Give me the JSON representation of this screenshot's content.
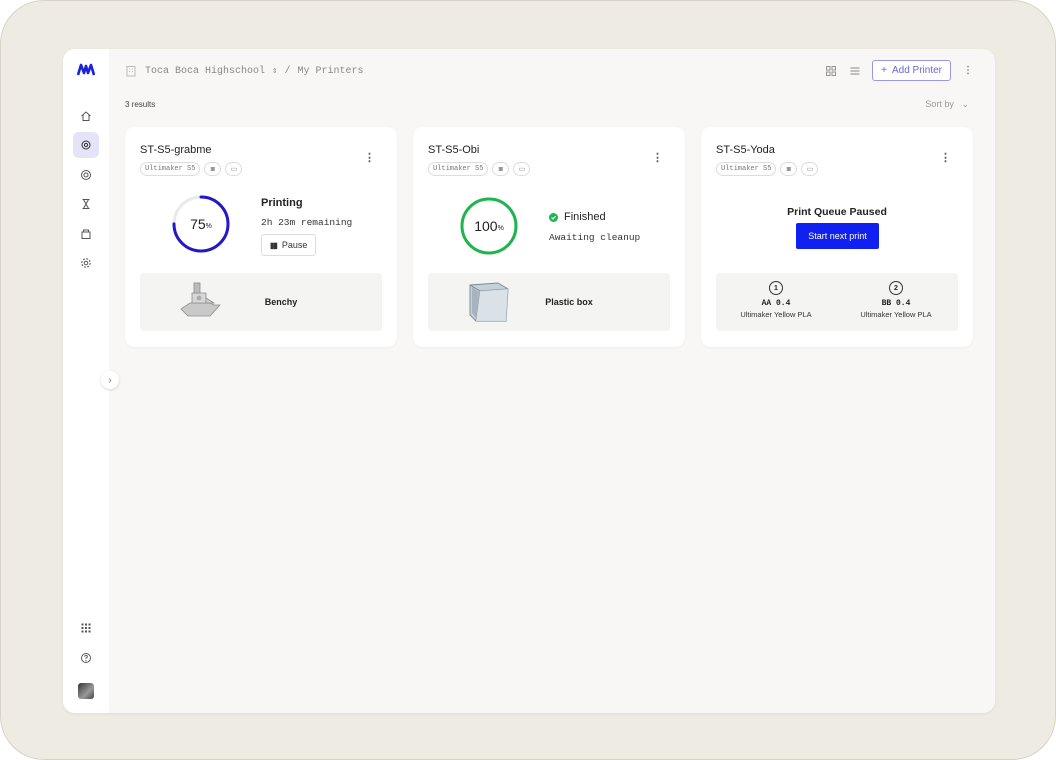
{
  "breadcrumb": {
    "org": "Toca Boca Highschool",
    "separator": "/",
    "page": "My Printers"
  },
  "toolbar": {
    "add_printer_label": "Add Printer"
  },
  "results_text": "3 results",
  "sort_label": "Sort by",
  "colors": {
    "accent": "#1020f0",
    "ring_printing": "#2218c8",
    "ring_finished": "#1fb54e",
    "nav_active_bg": "#e4e3f7"
  },
  "icons": {
    "sidebar": [
      "home-icon",
      "printers-icon",
      "materials-icon",
      "queue-icon",
      "storage-icon",
      "settings-icon"
    ],
    "sidebar_bottom": [
      "apps-grid-icon",
      "help-icon",
      "avatar"
    ]
  },
  "printers": [
    {
      "name": "ST-S5-grabme",
      "model": "Ultimaker S5",
      "progress": 75,
      "progress_unit": "%",
      "status": "Printing",
      "sub_status": "2h 23m remaining",
      "action_label": "Pause",
      "job_name": "Benchy"
    },
    {
      "name": "ST-S5-Obi",
      "model": "Ultimaker S5",
      "progress": 100,
      "progress_unit": "%",
      "status": "Finished",
      "sub_status": "Awaiting cleanup",
      "job_name": "Plastic box"
    },
    {
      "name": "ST-S5-Yoda",
      "model": "Ultimaker S5",
      "status": "Print Queue Paused",
      "action_label": "Start next print",
      "cores": [
        {
          "slot": "1",
          "type": "AA 0.4",
          "material": "Ultimaker Yellow PLA"
        },
        {
          "slot": "2",
          "type": "BB 0.4",
          "material": "Ultimaker Yellow PLA"
        }
      ]
    }
  ]
}
